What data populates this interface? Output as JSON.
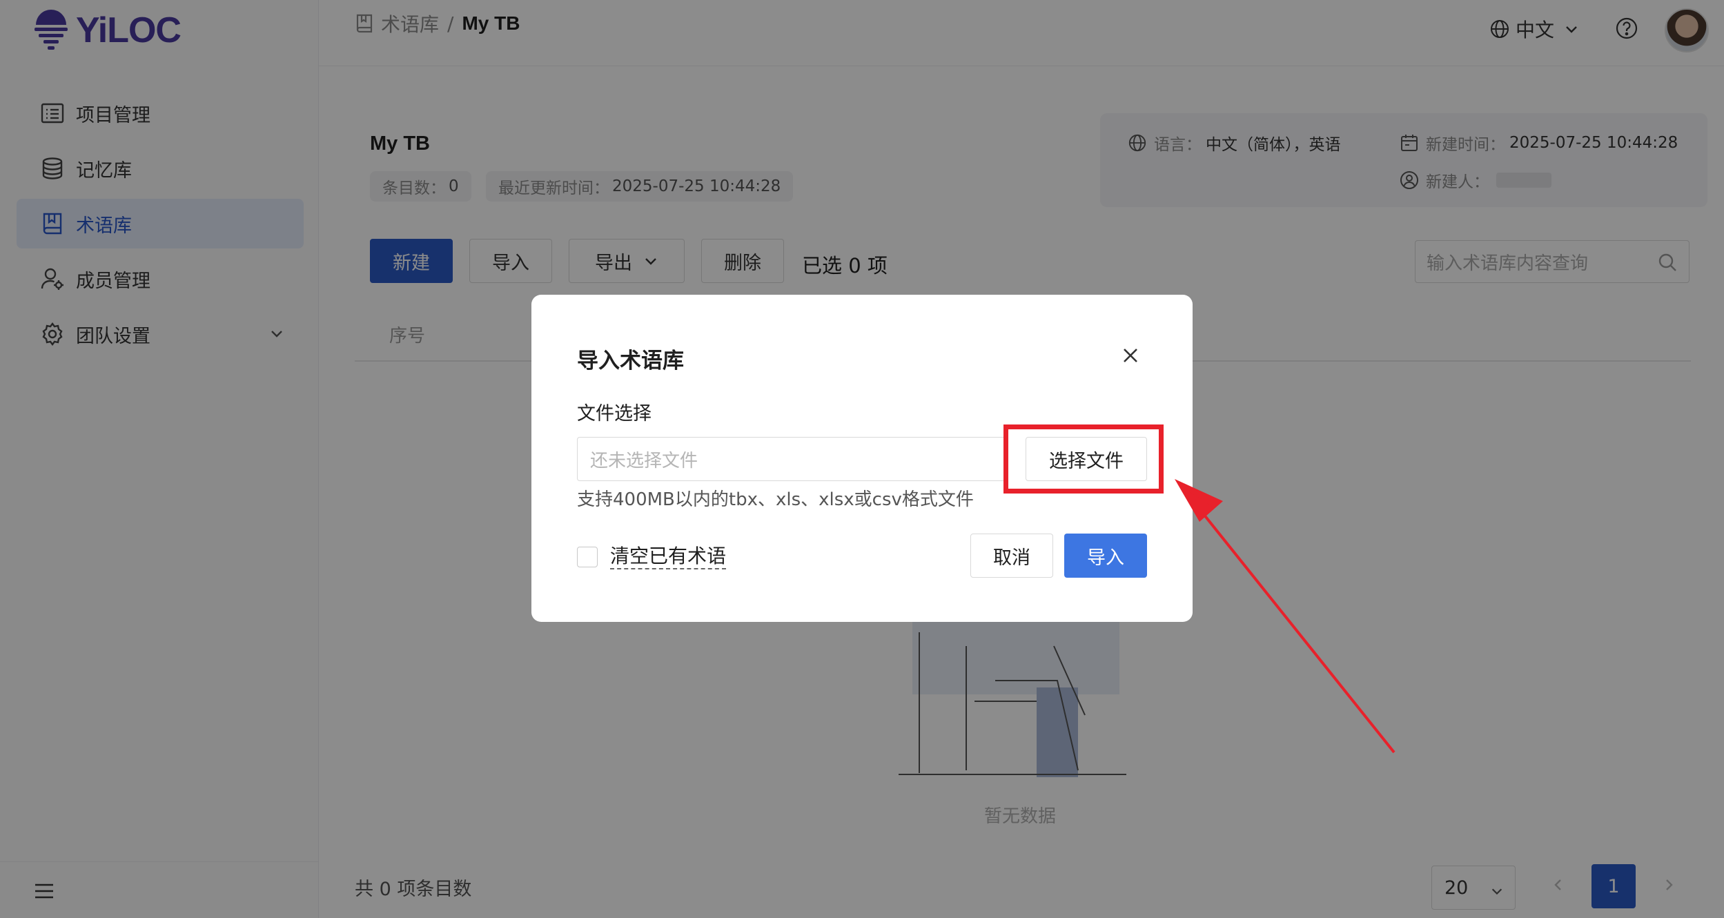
{
  "app": {
    "logo_text": "YiLOC"
  },
  "sidebar": {
    "items": [
      {
        "label": "项目管理",
        "icon": "list-icon"
      },
      {
        "label": "记忆库",
        "icon": "database-icon"
      },
      {
        "label": "术语库",
        "icon": "book-icon",
        "active": true
      },
      {
        "label": "成员管理",
        "icon": "user-gear-icon"
      },
      {
        "label": "团队设置",
        "icon": "gear-icon"
      }
    ]
  },
  "header": {
    "breadcrumb_parent": "术语库",
    "breadcrumb_sep": "/",
    "breadcrumb_current": "My TB",
    "language": "中文"
  },
  "termbase": {
    "title": "My TB",
    "count_label": "条目数：",
    "count_value": "0",
    "updated_label": "最近更新时间：",
    "updated_value": "2025-07-25 10:44:28",
    "lang_label": "语言：",
    "lang_value": "中文（简体），英语",
    "created_label": "新建时间：",
    "created_value": "2025-07-25 10:44:28",
    "creator_label": "新建人："
  },
  "toolbar": {
    "new_label": "新建",
    "import_label": "导入",
    "export_label": "导出",
    "delete_label": "删除",
    "selected_text": "已选 0 项",
    "search_placeholder": "输入术语库内容查询"
  },
  "table": {
    "col_index": "序号",
    "empty_text": "暂无数据"
  },
  "footer": {
    "total_text": "共 0 项条目数",
    "page_size": "20",
    "current_page": "1"
  },
  "modal": {
    "title": "导入术语库",
    "field_label": "文件选择",
    "file_placeholder": "还未选择文件",
    "choose_label": "选择文件",
    "hint": "支持400MB以内的tbx、xls、xlsx或csv格式文件",
    "clear_label": "清空已有术语",
    "cancel_label": "取消",
    "import_label": "导入"
  },
  "colors": {
    "primary": "#2a59c5",
    "import_button": "#3d76e2",
    "highlight": "#e8212b",
    "logo": "#4a3a9e"
  }
}
